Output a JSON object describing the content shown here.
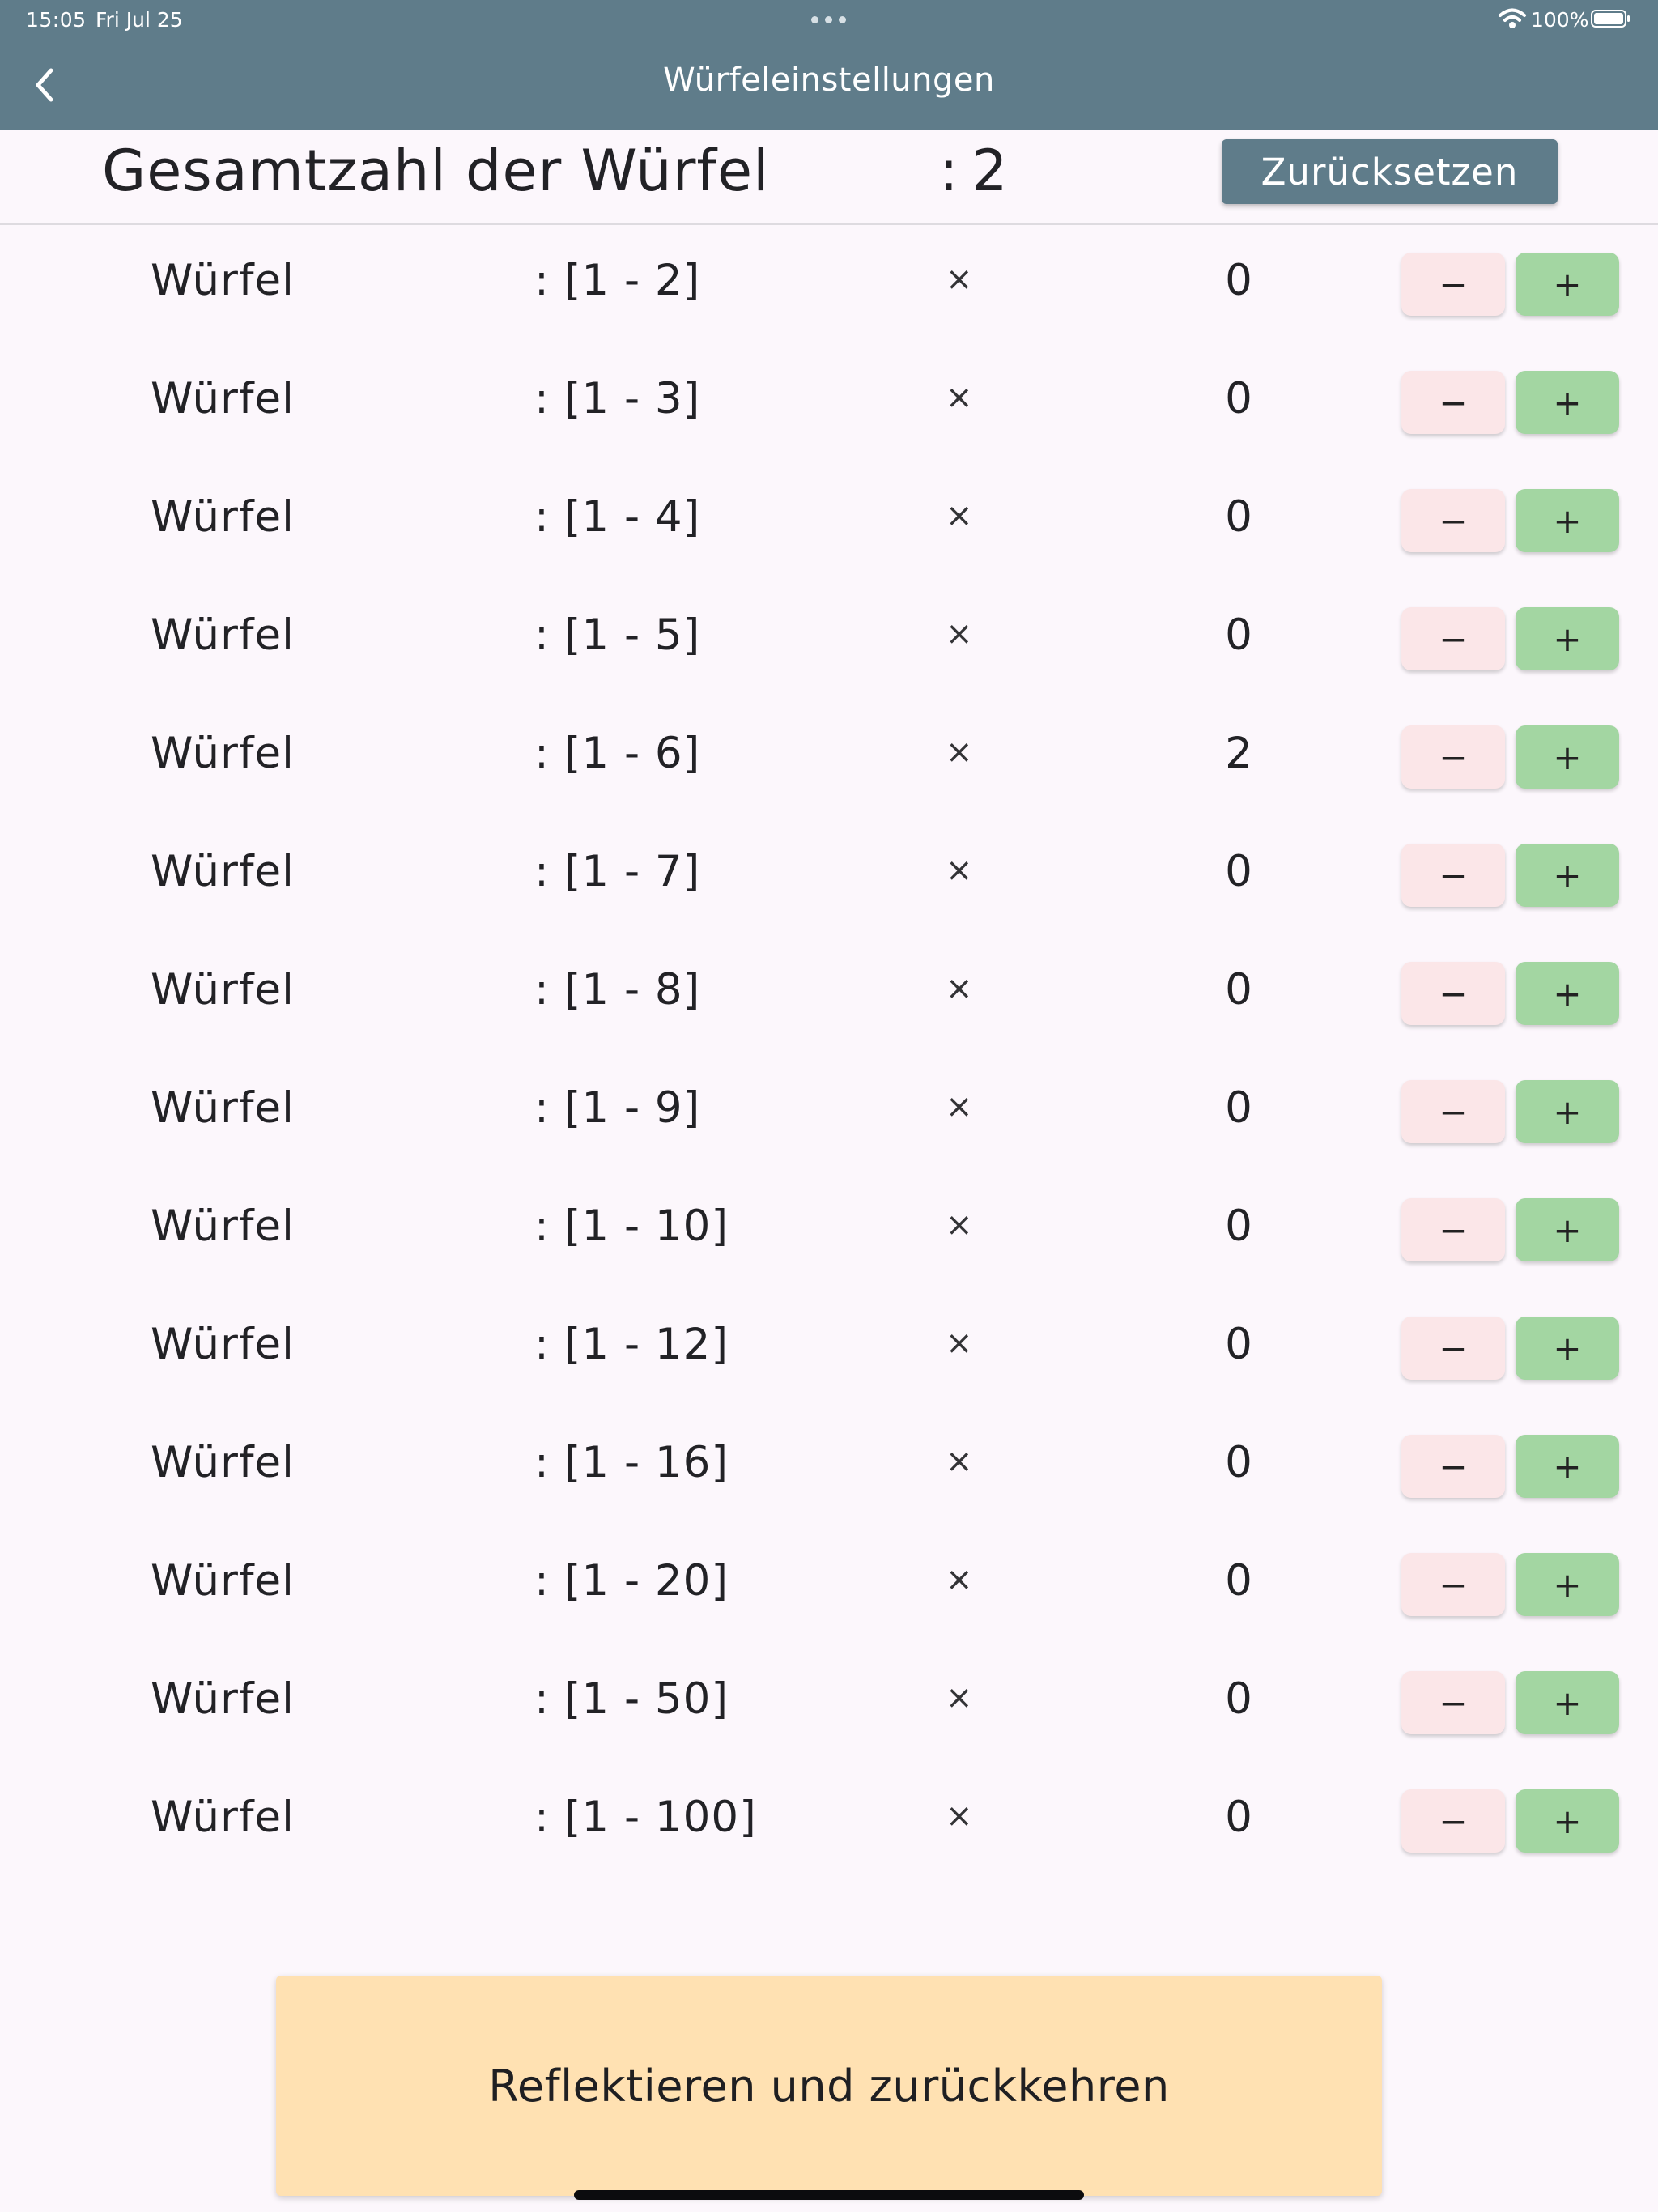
{
  "status_bar": {
    "time": "15:05",
    "date": "Fri Jul 25",
    "battery": "100%"
  },
  "nav": {
    "title": "Würfeleinstellungen",
    "back_icon": "chevron-left-icon"
  },
  "header": {
    "total_label": "Gesamtzahl der Würfel",
    "total_colon": ":",
    "total_value": "2",
    "reset_label": "Zurücksetzen"
  },
  "dice": [
    {
      "name": "Würfel",
      "range": ": [1 - 2]",
      "times": "×",
      "count": "0",
      "minus": "−",
      "plus": "+"
    },
    {
      "name": "Würfel",
      "range": ": [1 - 3]",
      "times": "×",
      "count": "0",
      "minus": "−",
      "plus": "+"
    },
    {
      "name": "Würfel",
      "range": ": [1 - 4]",
      "times": "×",
      "count": "0",
      "minus": "−",
      "plus": "+"
    },
    {
      "name": "Würfel",
      "range": ": [1 - 5]",
      "times": "×",
      "count": "0",
      "minus": "−",
      "plus": "+"
    },
    {
      "name": "Würfel",
      "range": ": [1 - 6]",
      "times": "×",
      "count": "2",
      "minus": "−",
      "plus": "+"
    },
    {
      "name": "Würfel",
      "range": ": [1 - 7]",
      "times": "×",
      "count": "0",
      "minus": "−",
      "plus": "+"
    },
    {
      "name": "Würfel",
      "range": ": [1 - 8]",
      "times": "×",
      "count": "0",
      "minus": "−",
      "plus": "+"
    },
    {
      "name": "Würfel",
      "range": ": [1 - 9]",
      "times": "×",
      "count": "0",
      "minus": "−",
      "plus": "+"
    },
    {
      "name": "Würfel",
      "range": ": [1 - 10]",
      "times": "×",
      "count": "0",
      "minus": "−",
      "plus": "+"
    },
    {
      "name": "Würfel",
      "range": ": [1 - 12]",
      "times": "×",
      "count": "0",
      "minus": "−",
      "plus": "+"
    },
    {
      "name": "Würfel",
      "range": ": [1 - 16]",
      "times": "×",
      "count": "0",
      "minus": "−",
      "plus": "+"
    },
    {
      "name": "Würfel",
      "range": ": [1 - 20]",
      "times": "×",
      "count": "0",
      "minus": "−",
      "plus": "+"
    },
    {
      "name": "Würfel",
      "range": ": [1 - 50]",
      "times": "×",
      "count": "0",
      "minus": "−",
      "plus": "+"
    },
    {
      "name": "Würfel",
      "range": ": [1 - 100]",
      "times": "×",
      "count": "0",
      "minus": "−",
      "plus": "+"
    }
  ],
  "footer": {
    "reflect_label": "Reflektieren und zurückkehren"
  },
  "colors": {
    "bar": "#5f7c8a",
    "background": "#fcf7fc",
    "minus_button": "#fbe6e8",
    "plus_button": "#a3d6a2",
    "reflect_button": "#ffe1b2"
  }
}
